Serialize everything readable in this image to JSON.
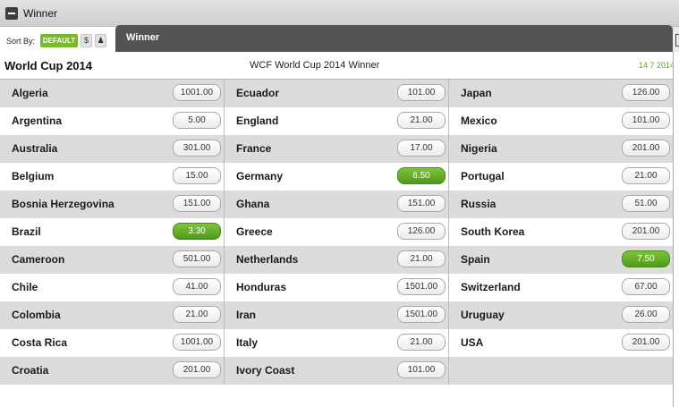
{
  "header": {
    "title": "Winner"
  },
  "sort": {
    "label": "Sort By:",
    "default_label": "DEFAULT",
    "price_icon": "$",
    "person_icon": "♟"
  },
  "tab": {
    "label": "Winner"
  },
  "event": {
    "title": "World Cup 2014",
    "subtitle": "WCF World Cup 2014 Winner",
    "date": "14 7 2014"
  },
  "selected_color": "#5aa822",
  "rows": [
    [
      {
        "team": "Algeria",
        "odds": "1001.00"
      },
      {
        "team": "Ecuador",
        "odds": "101.00"
      },
      {
        "team": "Japan",
        "odds": "126.00"
      }
    ],
    [
      {
        "team": "Argentina",
        "odds": "5.00"
      },
      {
        "team": "England",
        "odds": "21.00"
      },
      {
        "team": "Mexico",
        "odds": "101.00"
      }
    ],
    [
      {
        "team": "Australia",
        "odds": "301.00"
      },
      {
        "team": "France",
        "odds": "17.00"
      },
      {
        "team": "Nigeria",
        "odds": "201.00"
      }
    ],
    [
      {
        "team": "Belgium",
        "odds": "15.00"
      },
      {
        "team": "Germany",
        "odds": "6.50",
        "selected": true
      },
      {
        "team": "Portugal",
        "odds": "21.00"
      }
    ],
    [
      {
        "team": "Bosnia Herzegovina",
        "odds": "151.00"
      },
      {
        "team": "Ghana",
        "odds": "151.00"
      },
      {
        "team": "Russia",
        "odds": "51.00"
      }
    ],
    [
      {
        "team": "Brazil",
        "odds": "3.30",
        "selected": true
      },
      {
        "team": "Greece",
        "odds": "126.00"
      },
      {
        "team": "South Korea",
        "odds": "201.00"
      }
    ],
    [
      {
        "team": "Cameroon",
        "odds": "501.00"
      },
      {
        "team": "Netherlands",
        "odds": "21.00"
      },
      {
        "team": "Spain",
        "odds": "7.50",
        "selected": true
      }
    ],
    [
      {
        "team": "Chile",
        "odds": "41.00"
      },
      {
        "team": "Honduras",
        "odds": "1501.00"
      },
      {
        "team": "Switzerland",
        "odds": "67.00"
      }
    ],
    [
      {
        "team": "Colombia",
        "odds": "21.00"
      },
      {
        "team": "Iran",
        "odds": "1501.00"
      },
      {
        "team": "Uruguay",
        "odds": "26.00"
      }
    ],
    [
      {
        "team": "Costa Rica",
        "odds": "1001.00"
      },
      {
        "team": "Italy",
        "odds": "21.00"
      },
      {
        "team": "USA",
        "odds": "201.00"
      }
    ],
    [
      {
        "team": "Croatia",
        "odds": "201.00"
      },
      {
        "team": "Ivory Coast",
        "odds": "101.00"
      },
      null
    ]
  ]
}
